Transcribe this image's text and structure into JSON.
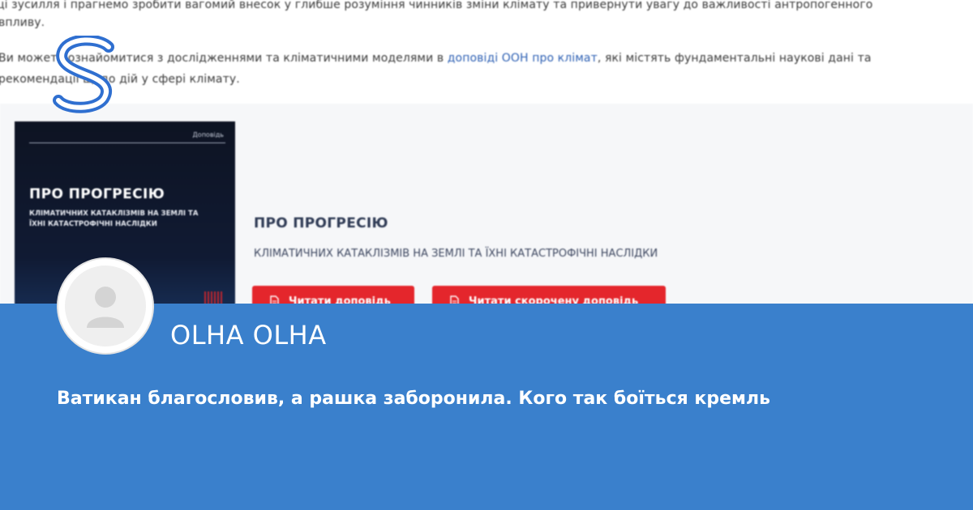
{
  "background_article": {
    "line1": "ці зусилля і прагнемо зробити вагомий внесок у глибше розуміння чинників зміни клімату та привернути увагу до важливості антропогенного",
    "line2": "впливу.",
    "line3_prefix": "Ви можете ознайомитися з дослідженнями та кліматичними моделями в",
    "line3_link": "доповіді ООН про клімат",
    "line3_suffix": ", які містять фундаментальні наукові дані та",
    "line4": "рекомендації щодо дій у сфері клімату."
  },
  "report": {
    "cover_brand": "Доповідь",
    "cover_title": "ПРО ПРОГРЕСІЮ",
    "cover_subtitle": "КЛІМАТИЧНИХ КАТАКЛІЗМІВ НА ЗЕМЛІ ТА ЇХНІ КАТАСТРОФІЧНІ НАСЛІДКИ",
    "title": "ПРО ПРОГРЕСІЮ",
    "subtitle": "КЛІМАТИЧНИХ КАТАКЛІЗМІВ НА ЗЕМЛІ ТА ЇХНІ КАТАСТРОФІЧНІ НАСЛІДКИ",
    "read_button": "Читати доповідь",
    "read_short_button": "Читати скорочену доповідь",
    "button_icon": "document-icon"
  },
  "logo": {
    "letter": "S",
    "icon": "site-logo"
  },
  "author": {
    "name": "OLHA OLHA",
    "avatar_icon": "user-avatar-icon"
  },
  "headline": "Ватикан благословив, а рашка заборонила. Кого так боїться кремль",
  "colors": {
    "band": "#3a80cc",
    "button_red": "#e4262c",
    "logo_blue": "#2f6fd0",
    "link": "#2c5fb3"
  }
}
